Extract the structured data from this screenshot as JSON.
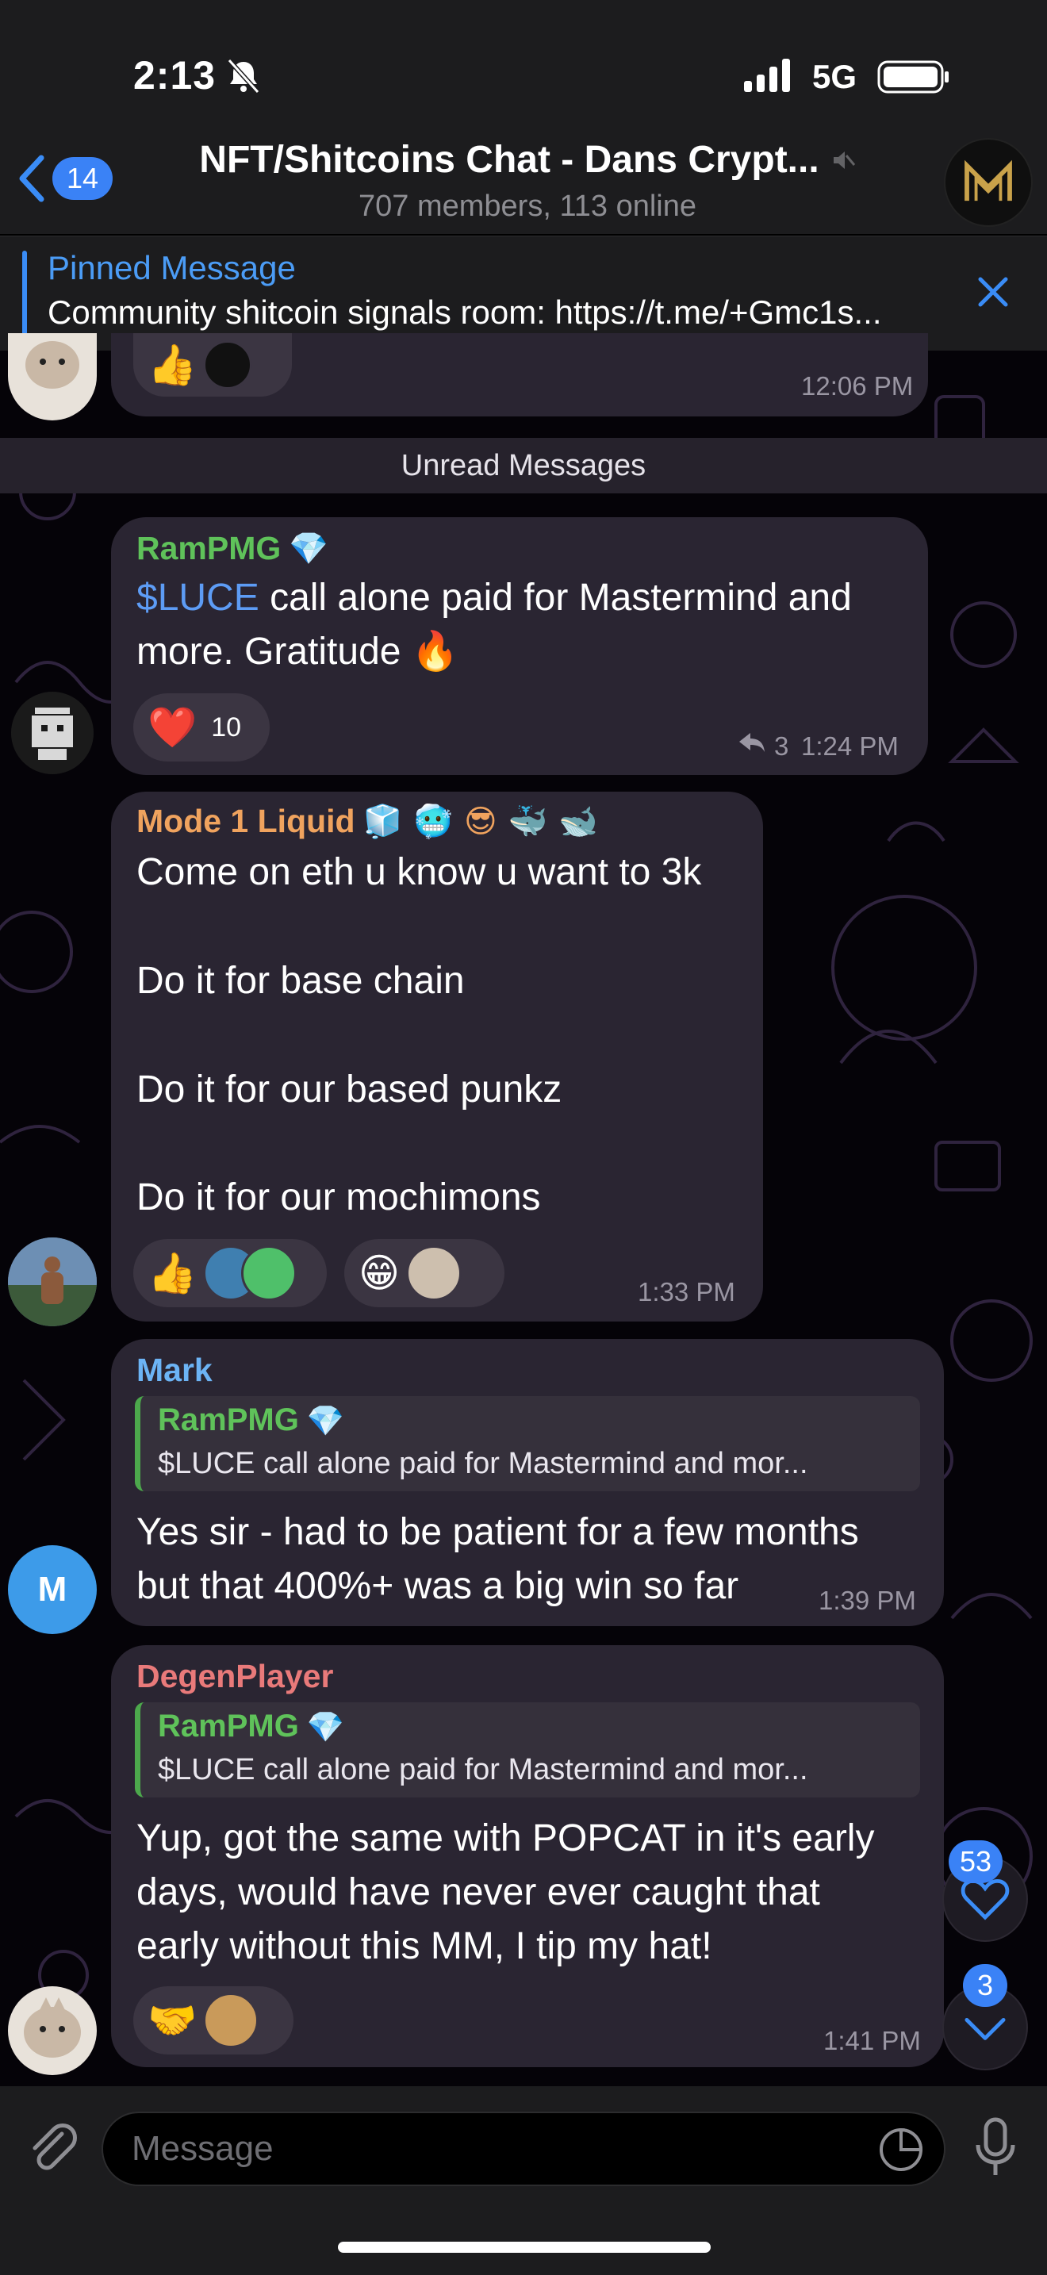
{
  "status_bar": {
    "time": "2:13",
    "network": "5G"
  },
  "header": {
    "back_count": "14",
    "title": "NFT/Shitcoins Chat - Dans Crypt...",
    "subtitle": "707 members, 113 online"
  },
  "pinned": {
    "label": "Pinned Message",
    "text": "Community shitcoin signals room: https://t.me/+Gmc1s..."
  },
  "partial_message": {
    "time": "12:06 PM",
    "reaction_emoji": "👍"
  },
  "unread_label": "Unread Messages",
  "messages": [
    {
      "sender": "RamPMG",
      "sender_badge": "💎",
      "link_text": "$LUCE",
      "text_line1": " call alone paid for Mastermind and",
      "text_line2": "more. Gratitude 🔥",
      "reaction_emoji": "❤️",
      "reaction_count": "10",
      "reply_count": "3",
      "time": "1:24 PM"
    },
    {
      "sender": "Mode 1 Liquid",
      "sender_emojis": "🧊 🥶 😎 🐳 🐋",
      "lines": [
        "Come on eth u know u want to 3k",
        "Do it for base chain",
        "Do it for our based punkz",
        "Do it for our mochimons"
      ],
      "reaction1_emoji": "👍",
      "reaction2_emoji": "😁",
      "time": "1:33 PM"
    },
    {
      "sender": "Mark",
      "avatar_letter": "M",
      "reply_name": "RamPMG",
      "reply_badge": "💎",
      "reply_text": "$LUCE call alone paid for Mastermind and mor...",
      "text_line1": "Yes sir - had to be patient for a few months",
      "text_line2": "but that 400%+ was a big win so far",
      "time": "1:39 PM"
    },
    {
      "sender": "DegenPlayer",
      "reply_name": "RamPMG",
      "reply_badge": "💎",
      "reply_text": "$LUCE call alone paid for Mastermind and mor...",
      "text_line1": "Yup, got the same with POPCAT in it's early",
      "text_line2": "days, would have never ever caught that",
      "text_line3": "early without this MM, I tip my hat!",
      "reaction_emoji": "🤝",
      "time": "1:41 PM"
    }
  ],
  "floating": {
    "reactions_badge": "53",
    "unread_badge": "3"
  },
  "composer": {
    "placeholder": "Message"
  },
  "colors": {
    "accent": "#3a82f6",
    "sender_green": "#5fc25a",
    "sender_orange": "#f0a35e",
    "sender_blue": "#6cb4f5",
    "sender_red": "#e97a7a",
    "bubble": "#2a2532"
  }
}
